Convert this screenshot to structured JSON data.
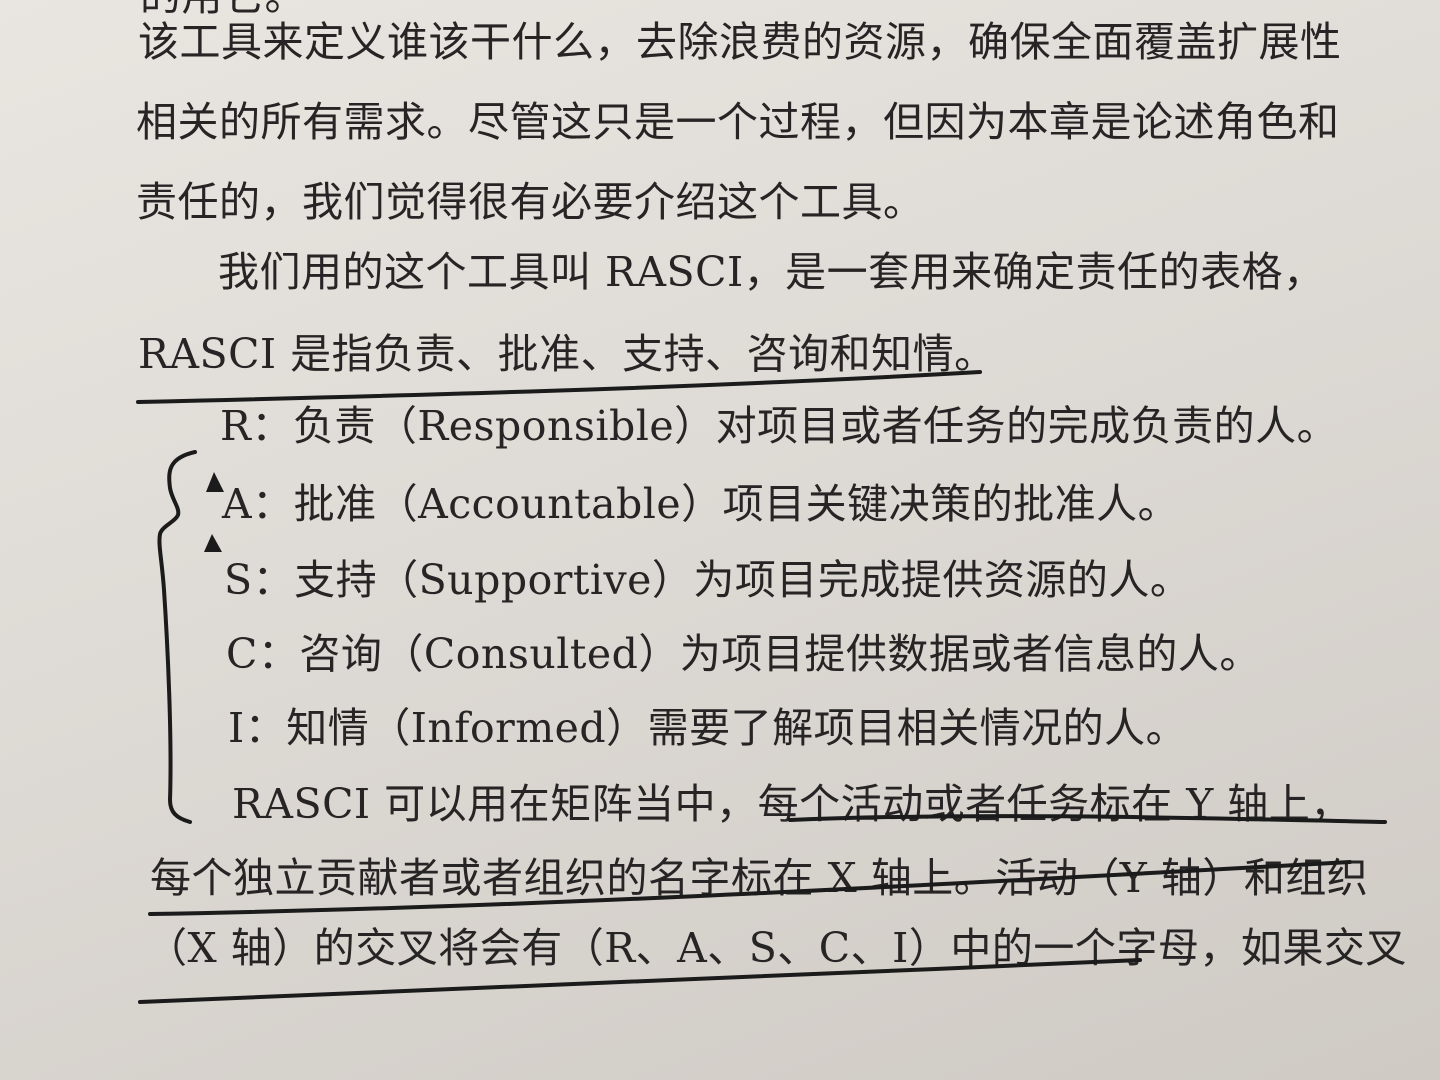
{
  "lines": [
    "的用它。",
    "该工具来定义谁该干什么，去除浪费的资源，确保全面覆盖扩展性",
    "相关的所有需求。尽管这只是一个过程，但因为本章是论述角色和",
    "责任的，我们觉得很有必要介绍这个工具。",
    "我们用的这个工具叫 RASCI，是一套用来确定责任的表格，",
    "RASCI 是指负责、批准、支持、咨询和知情。",
    "R：负责（Responsible）对项目或者任务的完成负责的人。",
    "A：批准（Accountable）项目关键决策的批准人。",
    "S：支持（Supportive）为项目完成提供资源的人。",
    "C：咨询（Consulted）为项目提供数据或者信息的人。",
    "I：知情（Informed）需要了解项目相关情况的人。",
    "RASCI 可以用在矩阵当中，每个活动或者任务标在 Y 轴上，",
    "每个独立贡献者或者组织的名字标在 X 轴上。活动（Y 轴）和组织",
    "（X 轴）的交叉将会有（R、A、S、C、I）中的一个字母，如果交叉"
  ]
}
